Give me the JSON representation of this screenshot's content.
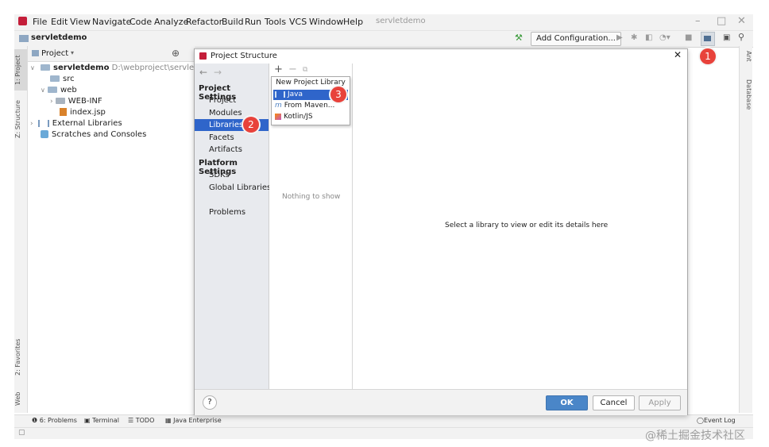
{
  "menu": [
    "File",
    "Edit",
    "View",
    "Navigate",
    "Code",
    "Analyze",
    "Refactor",
    "Build",
    "Run",
    "Tools",
    "VCS",
    "Window",
    "Help"
  ],
  "window_title": "servletdemo",
  "breadcrumb": "servletdemo",
  "toolbar": {
    "add_configuration": "Add Configuration..."
  },
  "project_panel": {
    "title": "Project",
    "root_name": "servletdemo",
    "root_path": "D:\\webproject\\servletdemo",
    "items": [
      "src",
      "web",
      "WEB-INF",
      "index.jsp",
      "External Libraries",
      "Scratches and Consoles"
    ]
  },
  "left_tabs": {
    "project": "1: Project",
    "structure": "Z: Structure",
    "favorites": "2: Favorites",
    "web": "Web"
  },
  "right_tabs": {
    "ant": "Ant",
    "database": "Database"
  },
  "dialog": {
    "title": "Project Structure",
    "project_settings": "Project Settings",
    "project_items": [
      "Project",
      "Modules",
      "Libraries",
      "Facets",
      "Artifacts"
    ],
    "platform_settings": "Platform Settings",
    "platform_items": [
      "SDKs",
      "Global Libraries"
    ],
    "problems": "Problems",
    "popup_title": "New Project Library",
    "popup_items": [
      "Java",
      "From Maven...",
      "Kotlin/JS"
    ],
    "nothing_to_show": "Nothing to show",
    "details_placeholder": "Select a library to view or edit its details here",
    "help": "?",
    "ok": "OK",
    "cancel": "Cancel",
    "apply": "Apply"
  },
  "bottom_tabs": [
    "6: Problems",
    "Terminal",
    "TODO",
    "Java Enterprise"
  ],
  "event_log": "Event Log",
  "annotations": [
    "1",
    "2",
    "3"
  ],
  "watermark": "@稀土掘金技术社区",
  "colors": {
    "selection": "#2f65ca",
    "badge": "#e8423b",
    "ok_button": "#4a86c8"
  }
}
